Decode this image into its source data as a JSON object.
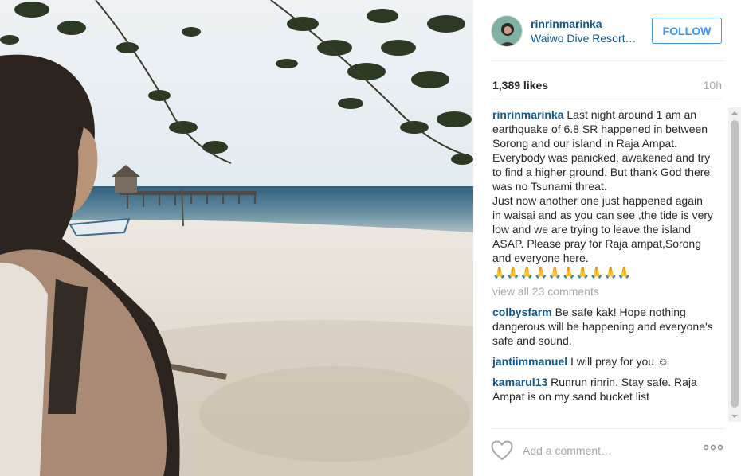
{
  "photo": {
    "alt_name": "beach-photo"
  },
  "header": {
    "username": "rinrinmarinka",
    "location": "Waiwo Dive Resort…",
    "follow_label": "FOLLOW"
  },
  "stats": {
    "likes": "1,389 likes",
    "time": "10h"
  },
  "caption": {
    "username": "rinrinmarinka",
    "lines": [
      "Last night around 1 am an earthquake of 6.8 SR happened in between Sorong and our island in Raja Ampat.",
      "Everybody was panicked, awakened and try to find a higher ground. But thank God there was no Tsunami threat.",
      "Just now another one just happened again in waisai and as you can see ,the tide is very low and we are trying to leave the island ASAP. Please pray for Raja ampat,Sorong and everyone here.",
      "🙏🙏🙏🙏🙏🙏🙏🙏🙏🙏"
    ]
  },
  "view_all": "view all 23 comments",
  "comments": [
    {
      "user": "colbysfarm",
      "text": "Be safe kak! Hope nothing dangerous will be happening and everyone's safe and sound."
    },
    {
      "user": "jantiimmanuel",
      "text": "I will pray for you ☺"
    },
    {
      "user": "kamarul13",
      "text": "Runrun rinrin. Stay safe. Raja Ampat is on my sand bucket list"
    }
  ],
  "footer": {
    "add_comment_placeholder": "Add a comment…"
  },
  "icons": {
    "like": "heart-icon",
    "more": "more-options-icon"
  },
  "colors": {
    "link": "#125688",
    "accent": "#3897f0",
    "muted": "#a5a7aa"
  }
}
